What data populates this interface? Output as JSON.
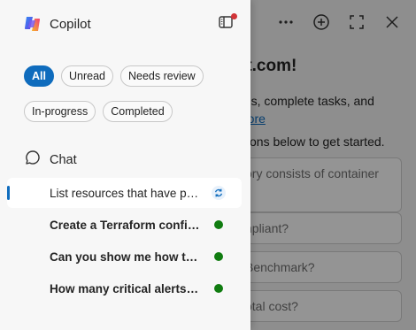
{
  "panel": {
    "title": "Copilot",
    "filters": [
      {
        "label": "All",
        "active": true
      },
      {
        "label": "Unread",
        "active": false
      },
      {
        "label": "Needs review",
        "active": false
      },
      {
        "label": "In-progress",
        "active": false
      },
      {
        "label": "Completed",
        "active": false
      }
    ],
    "chat_section_label": "Chat",
    "conversations": [
      {
        "title": "List resources that have public IP addresses",
        "status": "in-progress",
        "selected": true
      },
      {
        "title": "Create a Terraform configuration",
        "status": "completed",
        "selected": false
      },
      {
        "title": "Can you show me how to ...",
        "status": "completed",
        "selected": false
      },
      {
        "title": "How many critical alerts do I have?",
        "status": "completed",
        "selected": false
      }
    ]
  },
  "main": {
    "welcome_fragment": "ft.com!",
    "intro_line1": "ons, complete tasks, and",
    "intro_link": "more",
    "hint": "stions below to get started.",
    "suggestions": [
      "ory consists of container",
      "npliant?",
      "Benchmark?",
      "otal cost?"
    ]
  },
  "colors": {
    "accent": "#0f6cbd",
    "completed": "#107c10",
    "notification": "#d13438"
  },
  "icons": {
    "logo": "copilot-logo",
    "toolbar": [
      "more-icon",
      "add-icon",
      "expand-icon",
      "close-icon"
    ],
    "panel_toggle": "panel-toggle-icon",
    "chat": "chat-bubble-icon",
    "in_progress": "sync-icon",
    "completed": "check-dot-icon"
  }
}
